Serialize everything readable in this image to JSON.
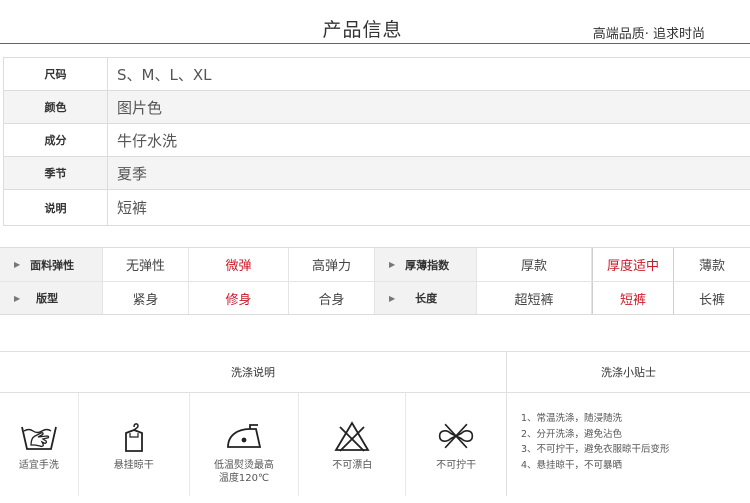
{
  "header": {
    "title": "产品信息",
    "slogan": "高端品质· 追求时尚"
  },
  "info_rows": [
    {
      "label": "尺码",
      "value": "S、M、L、XL"
    },
    {
      "label": "颜色",
      "value": "图片色"
    },
    {
      "label": "成分",
      "value": "牛仔水洗"
    },
    {
      "label": "季节",
      "value": "夏季"
    },
    {
      "label": "说明",
      "value": "短裤"
    }
  ],
  "attributes": {
    "row1": {
      "head1": "面料弹性",
      "opts1": [
        "无弹性",
        "微弹",
        "高弹力"
      ],
      "head2": "厚薄指数",
      "opts2": [
        "厚款",
        "厚度适中",
        "薄款"
      ]
    },
    "row2": {
      "head1": "版型",
      "opts1": [
        "紧身",
        "修身",
        "合身"
      ],
      "head2": "长度",
      "opts2": [
        "超短裤",
        "短裤",
        "长裤"
      ]
    },
    "highlight_color": "#cc1a2a"
  },
  "care": {
    "title": "洗涤说明",
    "tips_title": "洗涤小贴士",
    "icons": [
      {
        "icon": "hand-wash-icon",
        "label": "适宜手洗"
      },
      {
        "icon": "hang-dry-icon",
        "label": "悬挂晾干"
      },
      {
        "icon": "iron-low-icon",
        "label": "低温熨烫最高\n温度120℃"
      },
      {
        "icon": "no-bleach-icon",
        "label": "不可漂白"
      },
      {
        "icon": "no-wring-icon",
        "label": "不可拧干"
      }
    ],
    "tips": [
      "1、常温洗涤，随浸随洗",
      "2、分开洗涤，避免沾色",
      "3、不可拧干，避免衣服晾干后变形",
      "4、悬挂晾干，不可暴晒"
    ]
  }
}
